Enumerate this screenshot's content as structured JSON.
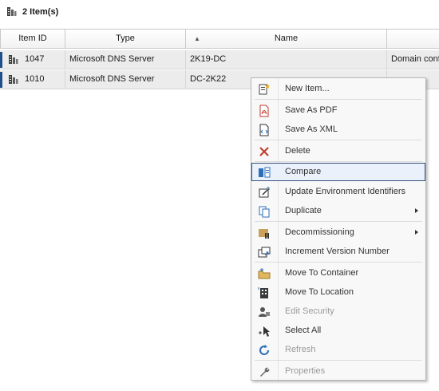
{
  "header": {
    "item_count": "2 Item(s)"
  },
  "columns": [
    "Item ID",
    "Type",
    "Name",
    ""
  ],
  "rows": [
    {
      "id": "1047",
      "type": "Microsoft DNS Server",
      "name": "2K19-DC",
      "extra": "Domain conf"
    },
    {
      "id": "1010",
      "type": "Microsoft DNS Server",
      "name": "DC-2K22",
      "extra": ""
    }
  ],
  "menu": [
    {
      "label": "New Item...",
      "icon": "new-item-icon"
    },
    {
      "label": "Save As PDF",
      "icon": "pdf-icon"
    },
    {
      "label": "Save As XML",
      "icon": "xml-icon"
    },
    {
      "label": "Delete",
      "icon": "delete-x-icon"
    },
    {
      "label": "Compare",
      "icon": "compare-icon"
    },
    {
      "label": "Update Environment Identifiers",
      "icon": "update-identifiers-icon"
    },
    {
      "label": "Duplicate",
      "icon": "duplicate-icon"
    },
    {
      "label": "Decommissioning",
      "icon": "decommission-icon"
    },
    {
      "label": "Increment Version Number",
      "icon": "increment-version-icon"
    },
    {
      "label": "Move To Container",
      "icon": "move-container-icon"
    },
    {
      "label": "Move To Location",
      "icon": "move-location-icon"
    },
    {
      "label": "Edit Security",
      "icon": "security-icon"
    },
    {
      "label": "Select All",
      "icon": "select-all-icon"
    },
    {
      "label": "Refresh",
      "icon": "refresh-icon"
    },
    {
      "label": "Properties",
      "icon": "wrench-icon"
    }
  ],
  "colors": {
    "highlight_border": "#33527c",
    "row_marker": "#1f4e8c",
    "delete_red": "#c0392b",
    "accent_blue": "#2c6fb7"
  }
}
